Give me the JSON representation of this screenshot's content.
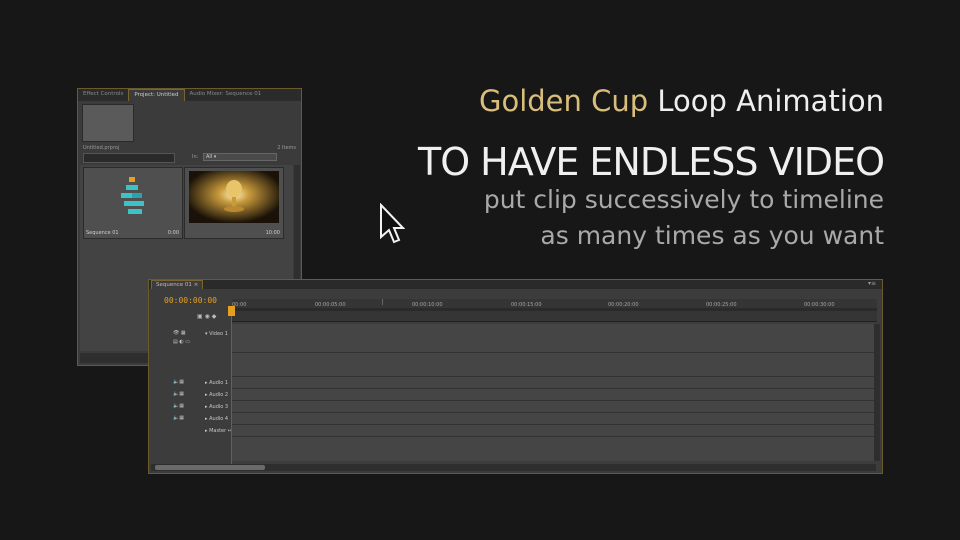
{
  "headline": {
    "part1": "Golden Cup",
    "part2": " Loop Animation",
    "big": "TO HAVE ENDLESS VIDEO",
    "sub1": "put clip successively to timeline",
    "sub2": "as many times as you want"
  },
  "project_panel": {
    "tabs": [
      "Effect Controls",
      "Project: Untitled",
      "Audio Mixer: Sequence 01"
    ],
    "project_name": "Untitled.prproj",
    "items_count": "2 Items",
    "in_label": "In:",
    "in_value": "All",
    "clips": [
      {
        "name": "Sequence 01",
        "duration": "0:00"
      },
      {
        "name": "",
        "duration": "10:00"
      }
    ]
  },
  "timeline_panel": {
    "tab": "Sequence 01 ×",
    "timecode": "00:00:00:00",
    "ruler_labels": [
      "00:00",
      "00:00:05:00",
      "00:00:10:00",
      "00:00:15:00",
      "00:00:20:00",
      "00:00:25:00",
      "00:00:30:00"
    ],
    "tracks": [
      "Video 1",
      "Audio 1",
      "Audio 2",
      "Audio 3",
      "Audio 4",
      "Master"
    ]
  },
  "colors": {
    "accent_gold": "#d9bd7b",
    "timecode": "#e6a020",
    "playhead": "#c0392b"
  }
}
